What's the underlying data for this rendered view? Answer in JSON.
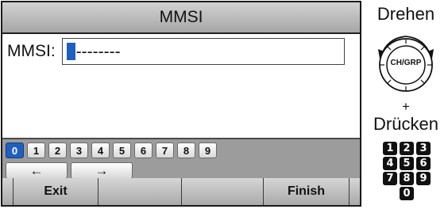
{
  "screen": {
    "title": "MMSI",
    "entry_label": "MMSI:",
    "entry_value": "--------"
  },
  "keyboard": {
    "digits": [
      "0",
      "1",
      "2",
      "3",
      "4",
      "5",
      "6",
      "7",
      "8",
      "9"
    ],
    "selected_digit": "0",
    "arrow_left": "←",
    "arrow_right": "→"
  },
  "softkeys": {
    "exit_label": "Exit",
    "finish_label": "Finish"
  },
  "instructions": {
    "rotate_label": "Drehen",
    "knob_label": "CH/GRP",
    "plus_label": "+",
    "press_label": "Drücken",
    "keypad_rows": [
      [
        "1",
        "2",
        "3"
      ],
      [
        "4",
        "5",
        "6"
      ],
      [
        "7",
        "8",
        "9"
      ],
      [
        "0"
      ]
    ]
  },
  "colors": {
    "selection_blue": "#1f5fbf",
    "keypad_key": "#111111"
  }
}
